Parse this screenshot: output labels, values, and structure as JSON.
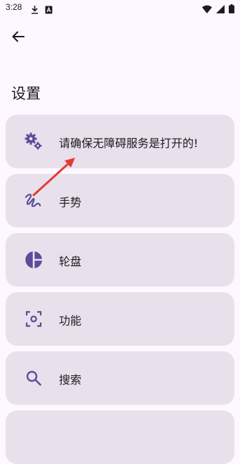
{
  "status_bar": {
    "time": "3:28",
    "left_icons": [
      "download-icon",
      "notification-a-icon"
    ],
    "right_icons": [
      "wifi-icon",
      "signal-icon",
      "battery-icon"
    ]
  },
  "header": {
    "back_icon": "arrow-back-icon"
  },
  "page": {
    "title": "设置"
  },
  "items": [
    {
      "label": "请确保无障碍服务是打开的!",
      "icon": "gears-icon"
    },
    {
      "label": "手势",
      "icon": "gesture-icon"
    },
    {
      "label": "轮盘",
      "icon": "pie-icon"
    },
    {
      "label": "功能",
      "icon": "focus-icon"
    },
    {
      "label": "搜索",
      "icon": "search-icon"
    }
  ],
  "colors": {
    "background": "#fdf7ff",
    "card": "#e8e1eb",
    "icon_accent": "#5c4d9a",
    "annotation_arrow": "#e53935"
  }
}
